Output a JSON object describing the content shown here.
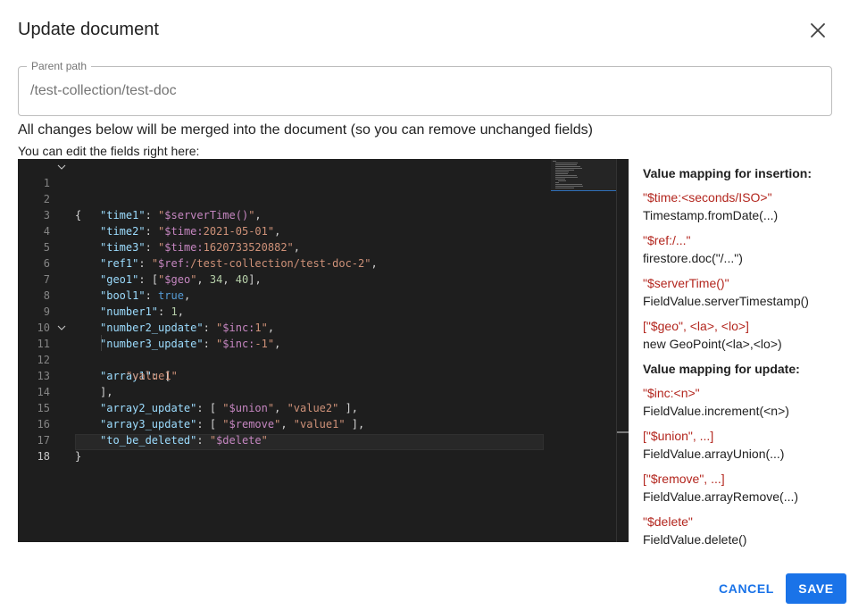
{
  "dialog": {
    "title": "Update document",
    "close_icon": "close-icon"
  },
  "parent_path": {
    "label": "Parent path",
    "value": "/test-collection/test-doc"
  },
  "notes": {
    "merge": "All changes below will be merged into the document (so you can remove unchanged fields)",
    "edit": "You can edit the fields right here:"
  },
  "editor": {
    "line_numbers": [
      "1",
      "2",
      "3",
      "4",
      "5",
      "6",
      "7",
      "8",
      "9",
      "10",
      "11",
      "12",
      "13",
      "14",
      "15",
      "16",
      "17",
      "18"
    ],
    "fold_icon": "chevron-down-icon",
    "tokens": {
      "l1_brace": "{",
      "l2_key": "\"time1\"",
      "l2_colon": ": ",
      "l2_value_quote_open": "\"",
      "l2_value_special": "$serverTime()",
      "l2_value_quote_close": "\"",
      "l2_comma": ",",
      "l3_key": "\"time2\"",
      "l3_colon": ": ",
      "l3_value_quote_open": "\"",
      "l3_value_special": "$time:",
      "l3_value_rest": "2021-05-01",
      "l3_value_quote_close": "\"",
      "l3_comma": ",",
      "l4_key": "\"time3\"",
      "l4_colon": ": ",
      "l4_value_quote_open": "\"",
      "l4_value_special": "$time:",
      "l4_value_rest": "1620733520882",
      "l4_value_quote_close": "\"",
      "l4_comma": ",",
      "l5_key": "\"ref1\"",
      "l5_colon": ": ",
      "l5_value_quote_open": "\"",
      "l5_value_special": "$ref:",
      "l5_value_rest": "/test-collection/test-doc-2",
      "l5_value_quote_close": "\"",
      "l5_comma": ",",
      "l6_key": "\"geo1\"",
      "l6_colon": ": ",
      "l6_bracket_open": "[",
      "l6_value_quote_open": "\"",
      "l6_value_special": "$geo",
      "l6_value_quote_close": "\"",
      "l6_sep1": ", ",
      "l6_num1": "34",
      "l6_sep2": ", ",
      "l6_num2": "40",
      "l6_bracket_close": "]",
      "l6_comma": ",",
      "l7_key": "\"bool1\"",
      "l7_colon": ": ",
      "l7_bool": "true",
      "l7_comma": ",",
      "l8_key": "\"number1\"",
      "l8_colon": ": ",
      "l8_num": "1",
      "l8_comma": ",",
      "l9_key": "\"number2_update\"",
      "l9_colon": ": ",
      "l9_value_quote_open": "\"",
      "l9_value_special": "$inc:",
      "l9_value_rest": "1",
      "l9_value_quote_close": "\"",
      "l9_comma": ",",
      "l10_key": "\"number3_update\"",
      "l10_colon": ": ",
      "l10_value_quote_open": "\"",
      "l10_value_special": "$inc:",
      "l10_value_rest": "-1",
      "l10_value_quote_close": "\"",
      "l10_comma": ",",
      "l11_key": "\"array1\"",
      "l11_colon": ": ",
      "l11_bracket": "[",
      "l12_value": "\"value1\"",
      "l13_bracket": "],",
      "l14_key": "\"array2_update\"",
      "l14_colon": ": ",
      "l14_bracket_open": "[ ",
      "l14_value_quote_open": "\"",
      "l14_value_special": "$union",
      "l14_value_quote_close": "\"",
      "l14_sep": ", ",
      "l14_value2": "\"value2\"",
      "l14_bracket_close": " ],",
      "l15_key": "\"array3_update\"",
      "l15_colon": ": ",
      "l15_bracket_open": "[ ",
      "l15_value_quote_open": "\"",
      "l15_value_special": "$remove",
      "l15_value_quote_close": "\"",
      "l15_sep": ", ",
      "l15_value2": "\"value1\"",
      "l15_bracket_close": " ],",
      "l16_key": "\"to_be_deleted\"",
      "l16_colon": ": ",
      "l16_value_quote_open": "\"",
      "l16_value_special": "$delete",
      "l16_value_quote_close": "\"",
      "l17_brace": "}"
    }
  },
  "value_mapping": {
    "insertion_heading": "Value mapping for insertion:",
    "insertion": [
      {
        "key": "\"$time:<seconds/ISO>\"",
        "value": "Timestamp.fromDate(...)"
      },
      {
        "key": "\"$ref:/...\"",
        "value": "firestore.doc(\"/...\")"
      },
      {
        "key": "\"$serverTime()\"",
        "value": "FieldValue.serverTimestamp()"
      },
      {
        "key": "[\"$geo\", <la>, <lo>]",
        "value": "new GeoPoint(<la>,<lo>)"
      }
    ],
    "update_heading": "Value mapping for update:",
    "update": [
      {
        "key": "\"$inc:<n>\"",
        "value": "FieldValue.increment(<n>)"
      },
      {
        "key": "[\"$union\", ...]",
        "value": "FieldValue.arrayUnion(...)"
      },
      {
        "key": "[\"$remove\", ...]",
        "value": "FieldValue.arrayRemove(...)"
      },
      {
        "key": "\"$delete\"",
        "value": "FieldValue.delete()"
      }
    ]
  },
  "buttons": {
    "cancel": "CANCEL",
    "save": "SAVE"
  },
  "colors": {
    "accent": "#1a73e8",
    "mapping_key": "#b3261e",
    "editor_background": "#1e1e1e"
  }
}
